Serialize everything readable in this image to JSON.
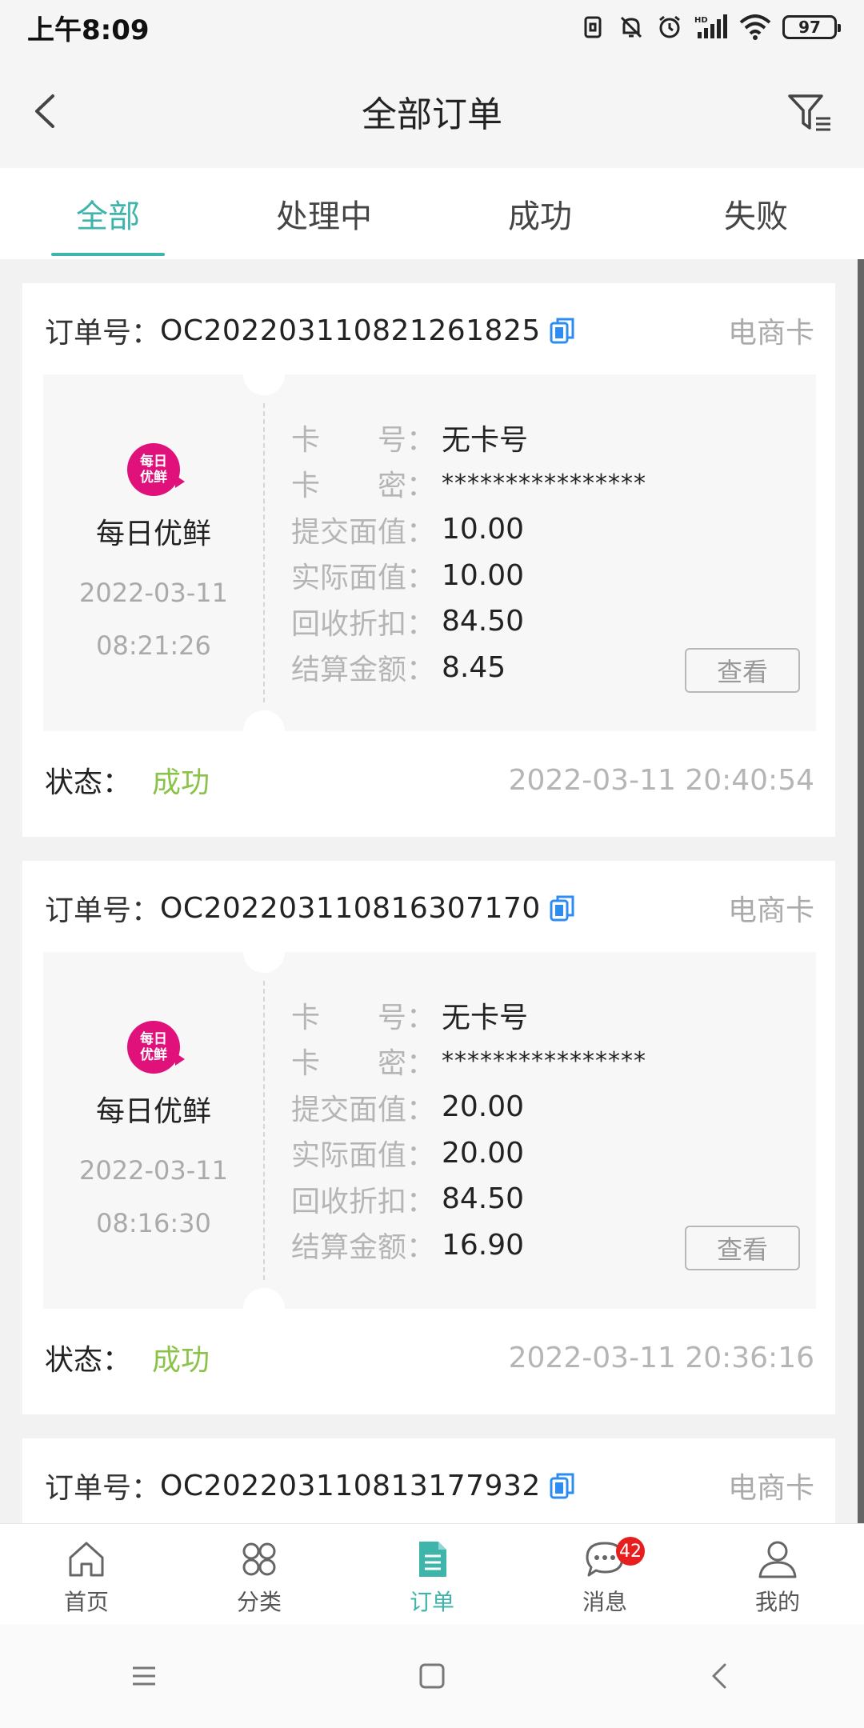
{
  "status_bar": {
    "time": "上午8:09",
    "battery": "97"
  },
  "header": {
    "title": "全部订单"
  },
  "tabs": [
    {
      "label": "全部",
      "active": true
    },
    {
      "label": "处理中",
      "active": false
    },
    {
      "label": "成功",
      "active": false
    },
    {
      "label": "失败",
      "active": false
    }
  ],
  "labels": {
    "order_no": "订单号：",
    "card_no": "卡　　号：",
    "card_pwd": "卡　　密：",
    "submit_value": "提交面值：",
    "actual_value": "实际面值：",
    "discount": "回收折扣：",
    "settle_amount": "结算金额：",
    "status": "状态：",
    "view_button": "查看"
  },
  "orders": [
    {
      "order_no": "OC202203110821261825",
      "card_type": "电商卡",
      "brand_logo_lines": [
        "每日",
        "优鲜"
      ],
      "brand": "每日优鲜",
      "date": "2022-03-11",
      "time": "08:21:26",
      "card_no": "无卡号",
      "card_pwd": "****************",
      "submit_value": "10.00",
      "actual_value": "10.00",
      "discount": "84.50",
      "settle_amount": "8.45",
      "status": "成功",
      "finish_time": "2022-03-11 20:40:54"
    },
    {
      "order_no": "OC202203110816307170",
      "card_type": "电商卡",
      "brand_logo_lines": [
        "每日",
        "优鲜"
      ],
      "brand": "每日优鲜",
      "date": "2022-03-11",
      "time": "08:16:30",
      "card_no": "无卡号",
      "card_pwd": "****************",
      "submit_value": "20.00",
      "actual_value": "20.00",
      "discount": "84.50",
      "settle_amount": "16.90",
      "status": "成功",
      "finish_time": "2022-03-11 20:36:16"
    },
    {
      "order_no": "OC202203110813177932",
      "card_type": "电商卡"
    }
  ],
  "bottom_nav": [
    {
      "label": "首页",
      "icon": "home-icon"
    },
    {
      "label": "分类",
      "icon": "category-icon"
    },
    {
      "label": "订单",
      "icon": "order-icon",
      "active": true
    },
    {
      "label": "消息",
      "icon": "message-icon",
      "badge": "42"
    },
    {
      "label": "我的",
      "icon": "profile-icon"
    }
  ],
  "colors": {
    "accent": "#3fb4ab",
    "success": "#8bc34a",
    "brand": "#e0117a",
    "badge": "#e61e1e"
  }
}
